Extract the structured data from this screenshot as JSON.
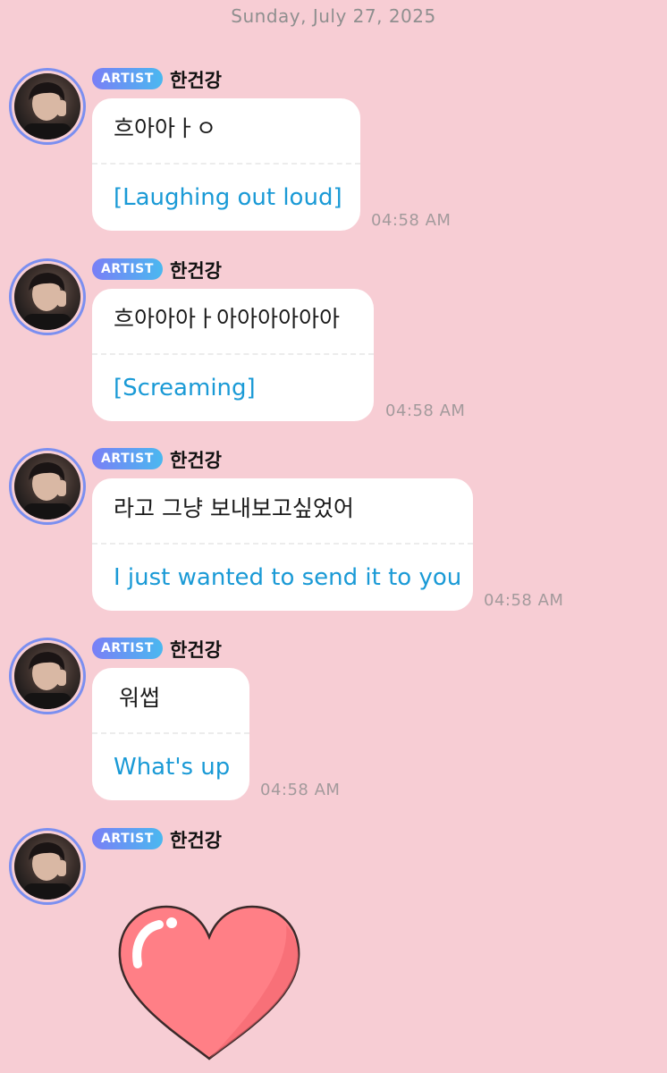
{
  "header": {
    "date": "Sunday, July 27, 2025"
  },
  "artist_badge": "ARTIST",
  "messages": [
    {
      "sender": "한건강",
      "original": "흐아아ㅏㅇ",
      "translation": "[Laughing out loud]",
      "time": "04:58 AM"
    },
    {
      "sender": "한건강",
      "original": "흐아아아ㅏ아아아아아아",
      "translation": "[Screaming]",
      "time": "04:58 AM"
    },
    {
      "sender": "한건강",
      "original": "라고 그냥 보내보고싶었어",
      "translation": "I just wanted to send it to you",
      "time": "04:58 AM"
    },
    {
      "sender": "한건강",
      "original": "워썹",
      "translation": "What's up",
      "time": "04:58 AM"
    },
    {
      "sender": "한건강",
      "sticker": "heart-sticker"
    }
  ],
  "colors": {
    "background": "#f7cdd4",
    "translation_text": "#1a9ad6",
    "badge_gradient_start": "#7a7ff6",
    "badge_gradient_end": "#4ab8f0",
    "heart": "#ff7f86"
  }
}
